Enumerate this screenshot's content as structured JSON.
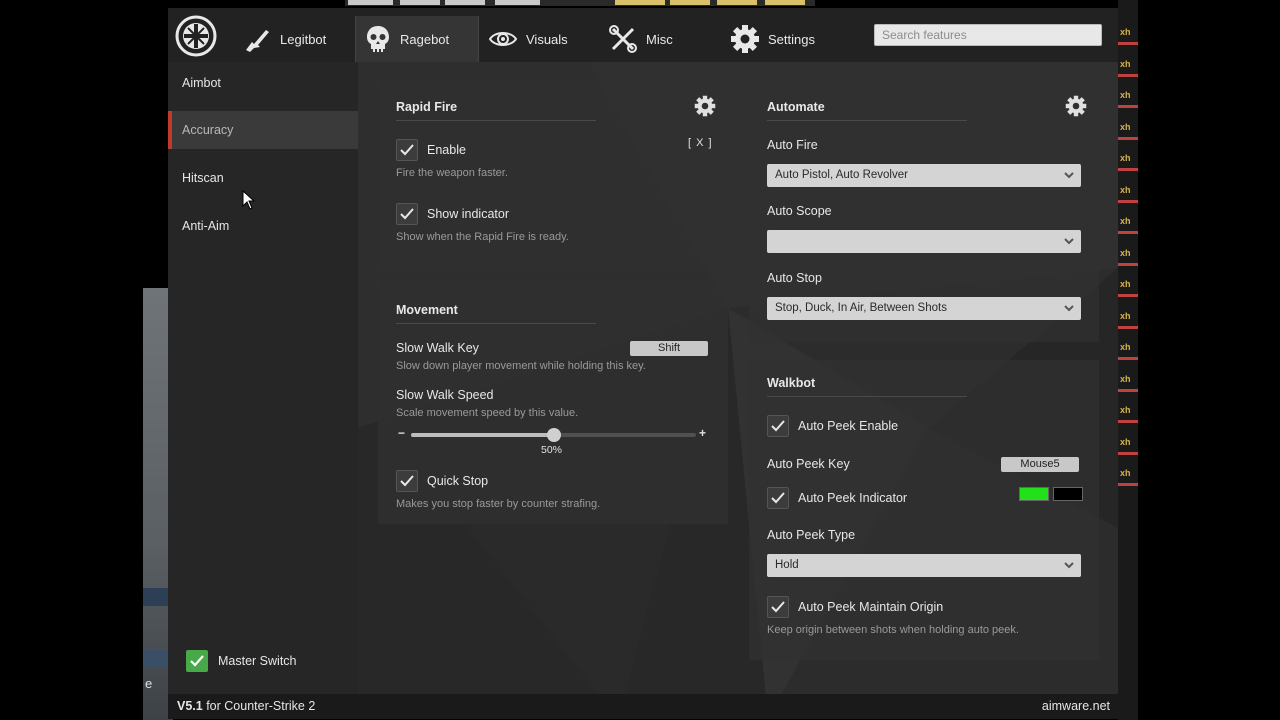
{
  "tabs": [
    {
      "label": "Legitbot",
      "icon": "rifle-icon"
    },
    {
      "label": "Ragebot",
      "icon": "skull-icon",
      "active": true
    },
    {
      "label": "Visuals",
      "icon": "eye-icon"
    },
    {
      "label": "Misc",
      "icon": "tools-icon"
    },
    {
      "label": "Settings",
      "icon": "gear-icon"
    }
  ],
  "search": {
    "placeholder": "Search features"
  },
  "sidebar": {
    "items": [
      {
        "label": "Aimbot"
      },
      {
        "label": "Accuracy",
        "active": true
      },
      {
        "label": "Hitscan"
      },
      {
        "label": "Anti-Aim"
      }
    ],
    "master_switch": {
      "label": "Master Switch",
      "checked": true
    }
  },
  "rapid_fire": {
    "title": "Rapid Fire",
    "key": "[ X ]",
    "enable": {
      "label": "Enable",
      "desc": "Fire the weapon faster.",
      "checked": true
    },
    "show_indicator": {
      "label": "Show indicator",
      "desc": "Show when the Rapid Fire is ready.",
      "checked": true
    }
  },
  "movement": {
    "title": "Movement",
    "slow_walk_key": {
      "label": "Slow Walk Key",
      "desc": "Slow down player movement while holding this key.",
      "value": "Shift"
    },
    "slow_walk_speed": {
      "label": "Slow Walk Speed",
      "desc": "Scale movement speed by this value.",
      "value_text": "50%",
      "value": 0.5,
      "minus": "−",
      "plus": "+"
    },
    "quick_stop": {
      "label": "Quick Stop",
      "desc": "Makes you stop faster by counter strafing.",
      "checked": true
    }
  },
  "automate": {
    "title": "Automate",
    "auto_fire": {
      "label": "Auto Fire",
      "value": "Auto Pistol, Auto Revolver"
    },
    "auto_scope": {
      "label": "Auto Scope",
      "value": ""
    },
    "auto_stop": {
      "label": "Auto Stop",
      "value": "Stop, Duck, In Air, Between Shots"
    }
  },
  "walkbot": {
    "title": "Walkbot",
    "auto_peek_enable": {
      "label": "Auto Peek Enable",
      "checked": true
    },
    "auto_peek_key": {
      "label": "Auto Peek Key",
      "value": "Mouse5"
    },
    "auto_peek_indicator": {
      "label": "Auto Peek Indicator",
      "checked": true,
      "colors": [
        "#22e01a",
        "#000000"
      ]
    },
    "auto_peek_type": {
      "label": "Auto Peek Type",
      "value": "Hold"
    },
    "auto_peek_maintain": {
      "label": "Auto Peek Maintain Origin",
      "desc": "Keep origin between shots when holding auto peek.",
      "checked": true
    }
  },
  "footer": {
    "version": "V5.1",
    "game": "for Counter-Strike 2",
    "site": "aimware.net"
  },
  "background": {
    "edge_text": "e",
    "xh_label": "xh"
  },
  "colors": {
    "accent": "#c0392b",
    "master_green": "#48a94a"
  }
}
